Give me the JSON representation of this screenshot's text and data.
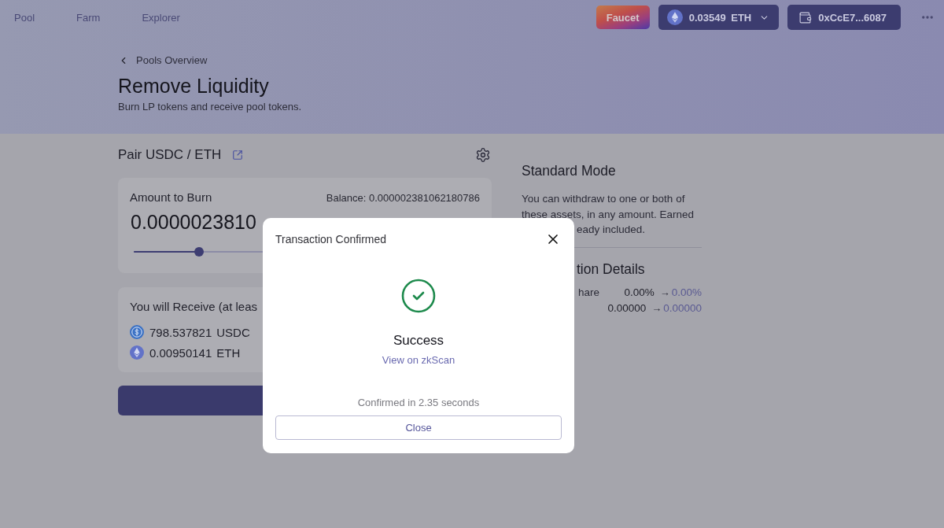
{
  "nav": [
    "Pool",
    "Farm",
    "Explorer"
  ],
  "toolbar": {
    "faucet_button": "Faucet",
    "balance_button": "0.03549 ETH",
    "wallet_button": "0xCcE7...6087"
  },
  "header": {
    "back_link": "Pools Overview",
    "title": "Remove Liquidity",
    "subtitle": "Burn LP tokens and receive pool tokens."
  },
  "pair": {
    "title": "Pair USDC / ETH"
  },
  "burn_card": {
    "label": "Amount to Burn",
    "balance": "Balance: 0.000002381062180786",
    "amount": "0.0000023810",
    "slider": {
      "level": 0.19
    }
  },
  "receive_card": {
    "title": "You will Receive (at leas",
    "tokens": [
      {
        "kind": "usdc",
        "amount": "798.537821",
        "symbol": "USDC"
      },
      {
        "kind": "eth",
        "amount": "0.00950141",
        "symbol": "ETH"
      }
    ]
  },
  "mode_panel": {
    "title": "Standard Mode",
    "description": "You can withdraw to one or both of these assets, in any amount. Earned",
    "description_tail": "eady included."
  },
  "details": {
    "title": "tion Details",
    "rows": [
      {
        "label": "hare",
        "before": "0.00%",
        "arrow": "→",
        "after": "0.00%"
      },
      {
        "before": "0.00000",
        "arrow": "→",
        "after": "0.00000"
      }
    ]
  },
  "modal": {
    "title": "Transaction Confirmed",
    "status": "Success",
    "link": "View on zkScan",
    "note": "Confirmed in 2.35 seconds",
    "close_button": "Close"
  }
}
